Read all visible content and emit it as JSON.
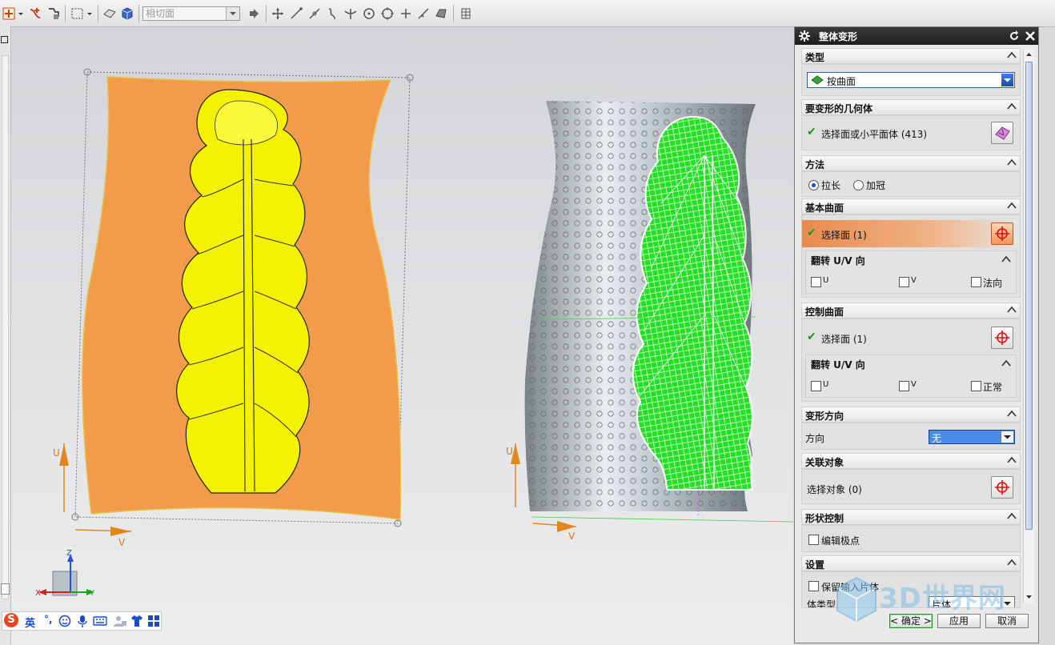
{
  "toolbar": {
    "filter_placeholder": "相切面",
    "colors": {
      "snap_red": "#d63c1a",
      "icon_blue": "#3a68c9"
    }
  },
  "viewport": {
    "left_model": {
      "surface_color": "#f29b4a",
      "leaf_color": "#f5f200",
      "axis_u": "U",
      "axis_v": "V"
    },
    "right_model": {
      "mesh_color": "#22e022",
      "axis_u": "U",
      "axis_v": "V"
    },
    "triad": {
      "x": "X",
      "y": "Y",
      "z": "Z"
    }
  },
  "ime": {
    "lang": "英",
    "logo": "S"
  },
  "dialog": {
    "title": "整体变形",
    "sections": {
      "type": {
        "label": "类型",
        "value": "按曲面"
      },
      "geometry": {
        "label": "要变形的几何体",
        "select_text": "选择面或小平面体 (413)"
      },
      "method": {
        "label": "方法",
        "option_stretch": "拉长",
        "option_crown": "加冠",
        "selected": "拉长"
      },
      "base_surface": {
        "label": "基本曲面",
        "select_text": "选择面 (1)",
        "flip_label": "翻转 U/V 向",
        "cb_u": "U",
        "cb_v": "V",
        "cb_normal": "法向"
      },
      "control_surface": {
        "label": "控制曲面",
        "select_text": "选择面 (1)",
        "flip_label": "翻转 U/V 向",
        "cb_u": "U",
        "cb_v": "V",
        "cb_normal": "正常"
      },
      "deform_dir": {
        "label": "变形方向",
        "dir_label": "方向",
        "dir_value": "无"
      },
      "associated": {
        "label": "关联对象",
        "select_text": "选择对象 (0)"
      },
      "shape_control": {
        "label": "形状控制",
        "edit_poles": "编辑极点"
      },
      "settings": {
        "label": "设置",
        "keep_input": "保留输入片体",
        "body_type_label": "体类型",
        "body_type_value": "片体"
      }
    },
    "buttons": {
      "ok": "< 确定 >",
      "apply": "应用",
      "cancel": "取消"
    },
    "colors": {
      "active_row": "#f0a86a",
      "title_bg": "#2a2a2a"
    }
  },
  "watermark": {
    "text": "3D世界网"
  }
}
